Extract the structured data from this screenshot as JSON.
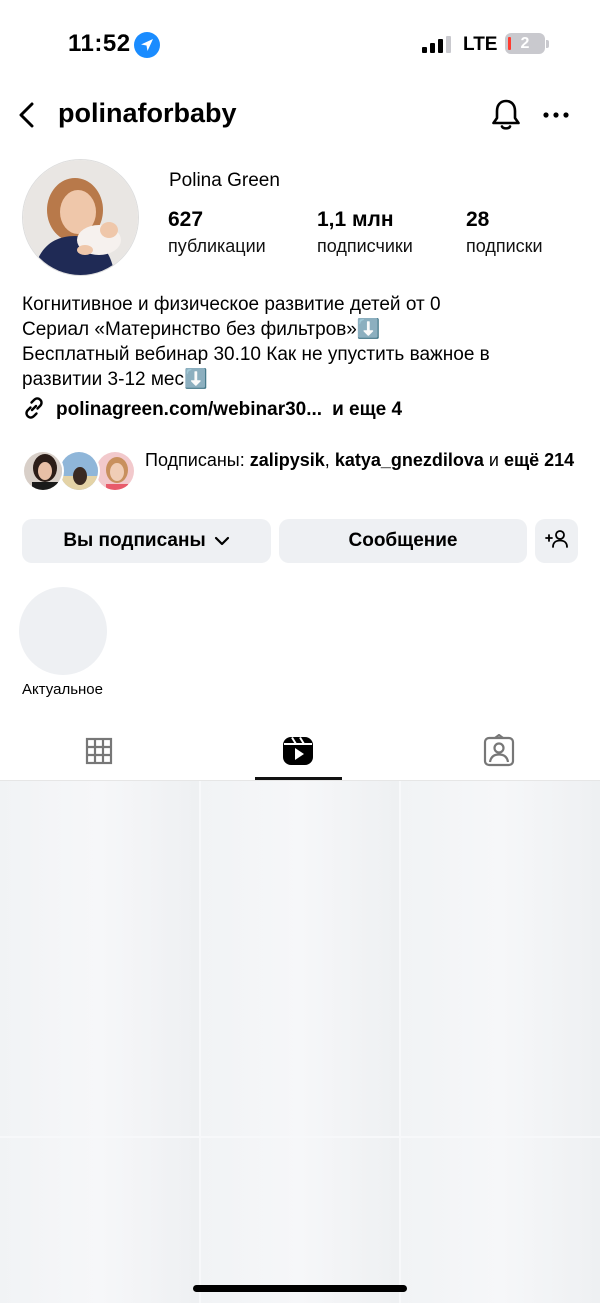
{
  "status_bar": {
    "time": "11:52",
    "network": "LTE",
    "battery": "2"
  },
  "header": {
    "username": "polinaforbaby"
  },
  "profile": {
    "full_name": "Polina Green",
    "stats": [
      {
        "value": "627",
        "label": "публикации"
      },
      {
        "value": "1,1 млн",
        "label": "подписчики"
      },
      {
        "value": "28",
        "label": "подписки"
      }
    ],
    "bio": [
      "Когнитивное и физическое развитие детей от 0",
      "Сериал «Материнство без фильтров»⬇️",
      "Бесплатный вебинар 30.10 Как не упустить важное в",
      "развитии 3-12 мес⬇️"
    ],
    "link": "polinagreen.com/webinar30...",
    "more_links": "и еще 4"
  },
  "followed_by": {
    "prefix": "Подписаны: ",
    "user1": "zalipysik",
    "sep": ", ",
    "user2": "katya_gnezdilova",
    "and": " и ",
    "more": "ещё 214"
  },
  "actions": {
    "following_label": "Вы подписаны",
    "message_label": "Сообщение"
  },
  "highlights": [
    {
      "label": "Актуальное"
    }
  ],
  "tabs": {
    "active": "reels"
  },
  "colors": {
    "location_badge": "#1a8cff",
    "button_bg": "#eef0f3",
    "battery_low": "#ff3b30"
  }
}
